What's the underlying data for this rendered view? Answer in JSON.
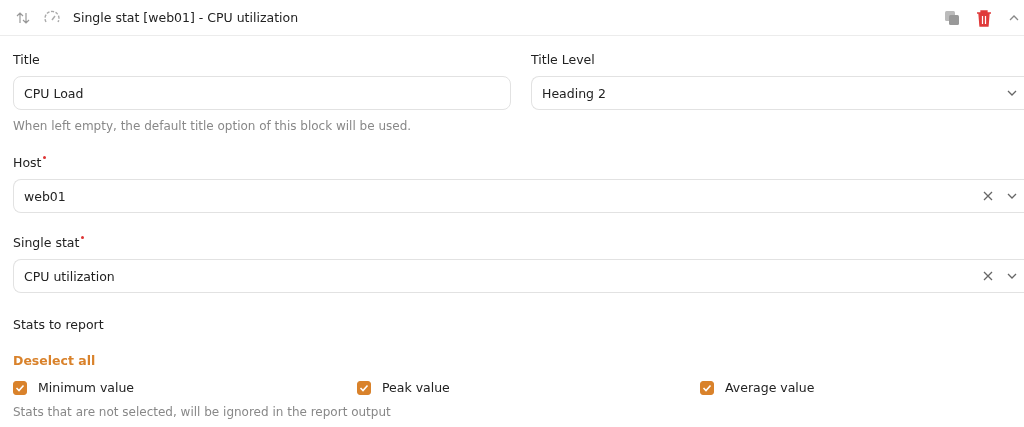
{
  "header": {
    "title": "Single stat [web01] - CPU utilization",
    "expanded": true
  },
  "title_field": {
    "label": "Title",
    "value": "CPU Load",
    "hint": "When left empty, the default title option of this block will be used."
  },
  "title_level": {
    "label": "Title Level",
    "value": "Heading 2"
  },
  "selects": [
    {
      "label": "Host",
      "required": true,
      "value": "web01"
    },
    {
      "label": "Single stat",
      "required": true,
      "value": "CPU utilization"
    }
  ],
  "stats": {
    "label": "Stats to report",
    "action": "Deselect all",
    "hint": "Stats that are not selected, will be ignored in the report output",
    "options": [
      {
        "label": "Minimum value",
        "checked": true
      },
      {
        "label": "Peak value",
        "checked": true
      },
      {
        "label": "Average value",
        "checked": true
      }
    ]
  }
}
